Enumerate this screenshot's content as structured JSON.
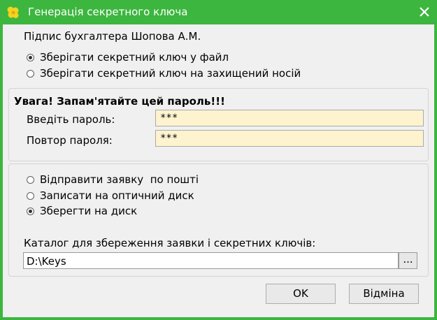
{
  "window": {
    "title": "Генерація секретного ключа"
  },
  "signature_label": "Підпис бухгалтера Шопова А.М.",
  "key_storage": {
    "options": [
      {
        "label": "Зберігати секретний ключ у файл",
        "selected": true
      },
      {
        "label": "Зберігати секретний ключ на захищений носій",
        "selected": false
      }
    ]
  },
  "password": {
    "warning": "Увага! Запам'ятайте цей пароль!!!",
    "enter_label": "Введіть пароль:",
    "enter_value": "***",
    "repeat_label": "Повтор пароля:",
    "repeat_value": "***"
  },
  "request": {
    "options": [
      {
        "label": "Відправити заявку  по пошті",
        "selected": false
      },
      {
        "label": "Записати на оптичний диск",
        "selected": false
      },
      {
        "label": "Зберегти на диск",
        "selected": true
      }
    ],
    "dir_label": "Каталог для збереження заявки і секретних ключів:",
    "dir_value": "D:\\Keys",
    "browse_label": "..."
  },
  "buttons": {
    "ok": "OK",
    "cancel": "Відміна"
  },
  "colors": {
    "titlebar": "#3cb63e",
    "password_field_bg": "#fdf4cf",
    "client_bg": "#f0f0f0"
  },
  "icons": {
    "app": "flower-icon",
    "close": "close-icon"
  }
}
